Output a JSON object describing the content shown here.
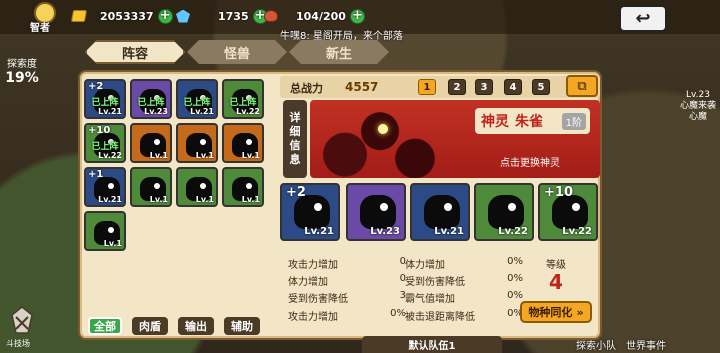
{
  "header": {
    "avatar_label": "智者",
    "gold": "2053337",
    "gems": "1735",
    "food": "104/200",
    "notice": "牛嘿8: 星阁开局，来个部落"
  },
  "tabs": [
    "阵容",
    "怪兽",
    "新生"
  ],
  "side_left": {
    "label": "探索度",
    "value": "19%"
  },
  "side_right": {
    "level": "Lv.23",
    "line1": "心魔来袭",
    "line2": "心魔"
  },
  "bottom_right": {
    "left": "探索小队",
    "right": "世界事件"
  },
  "bottom_left_label": "斗技场",
  "power": {
    "label": "总战力",
    "value": "4557"
  },
  "teams": [
    "1",
    "2",
    "3",
    "4",
    "5"
  ],
  "god": {
    "detail_tag": [
      "详",
      "细",
      "信",
      "息"
    ],
    "type": "神灵",
    "name": "朱雀",
    "rank": "1阶",
    "change": "点击更换神灵"
  },
  "cards": [
    {
      "plus": "+2",
      "deployed": "已上阵",
      "lv": "Lv.21",
      "color": "#2c4a86"
    },
    {
      "plus": "",
      "deployed": "已上阵",
      "lv": "Lv.23",
      "color": "#6a4aa6"
    },
    {
      "plus": "",
      "deployed": "已上阵",
      "lv": "Lv.21",
      "color": "#2c4a86"
    },
    {
      "plus": "",
      "deployed": "已上阵",
      "lv": "Lv.22",
      "color": "#4f8a3a"
    },
    {
      "plus": "+10",
      "deployed": "已上阵",
      "lv": "Lv.22",
      "color": "#4f8a3a"
    },
    {
      "plus": "",
      "deployed": "",
      "lv": "Lv.1",
      "color": "#c46a1a"
    },
    {
      "plus": "",
      "deployed": "",
      "lv": "Lv.1",
      "color": "#c46a1a"
    },
    {
      "plus": "",
      "deployed": "",
      "lv": "Lv.1",
      "color": "#c46a1a"
    },
    {
      "plus": "+1",
      "deployed": "",
      "lv": "Lv.21",
      "color": "#2c4a86"
    },
    {
      "plus": "",
      "deployed": "",
      "lv": "Lv.1",
      "color": "#4f8a3a"
    },
    {
      "plus": "",
      "deployed": "",
      "lv": "Lv.1",
      "color": "#4f8a3a"
    },
    {
      "plus": "",
      "deployed": "",
      "lv": "Lv.1",
      "color": "#4f8a3a"
    },
    {
      "plus": "",
      "deployed": "",
      "lv": "Lv.1",
      "color": "#4f8a3a"
    }
  ],
  "filters": [
    "全部",
    "肉盾",
    "输出",
    "辅助"
  ],
  "members": [
    {
      "plus": "+2",
      "lv": "Lv.21",
      "color": "#2c4a86"
    },
    {
      "plus": "",
      "lv": "Lv.23",
      "color": "#6a4aa6"
    },
    {
      "plus": "",
      "lv": "Lv.21",
      "color": "#2c4a86"
    },
    {
      "plus": "",
      "lv": "Lv.22",
      "color": "#4f8a3a"
    },
    {
      "plus": "+10",
      "lv": "Lv.22",
      "color": "#4f8a3a"
    }
  ],
  "stats_left": [
    {
      "label": "攻击力增加",
      "value": "0"
    },
    {
      "label": "体力增加",
      "value": "0"
    },
    {
      "label": "受到伤害降低",
      "value": "3"
    },
    {
      "label": "攻击力增加",
      "value": "0%"
    }
  ],
  "stats_right": [
    {
      "label": "体力增加",
      "value": "0%"
    },
    {
      "label": "受到伤害降低",
      "value": "0%"
    },
    {
      "label": "霸气值增加",
      "value": "0%"
    },
    {
      "label": "被击退距离降低",
      "value": "0%"
    }
  ],
  "level": {
    "label": "等级",
    "value": "4"
  },
  "merge_button": "物种同化",
  "team_label": "默认队伍1"
}
